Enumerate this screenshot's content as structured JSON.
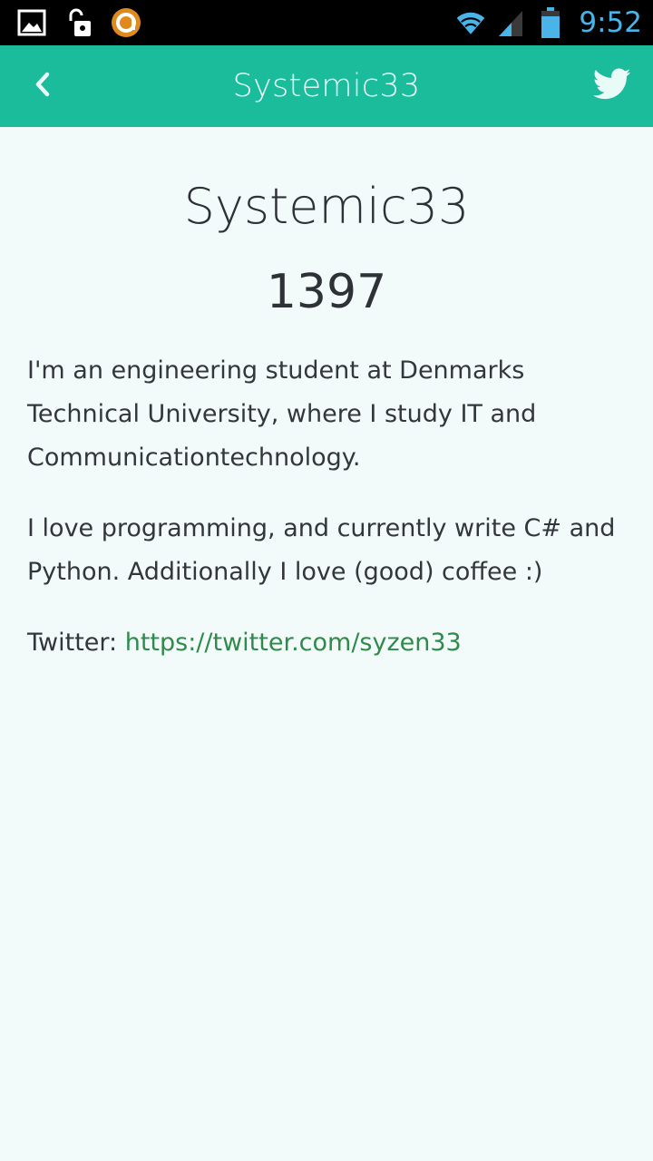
{
  "status_bar": {
    "time": "9:52",
    "icons": [
      "image-icon",
      "unlock-icon",
      "app-circle-icon",
      "wifi-icon",
      "signal-icon",
      "battery-icon"
    ]
  },
  "app_bar": {
    "title": "Systemic33",
    "color": "#1abc9c",
    "back_icon": "chevron-left-icon",
    "action_icon": "twitter-icon"
  },
  "profile": {
    "username": "Systemic33",
    "score": "1397",
    "about": {
      "paragraph1": "I'm an engineering student at Denmarks Technical University, where I study IT and Communicationtechnology.",
      "paragraph2": "I love programming, and currently write C# and Python. Additionally I love (good) coffee :)",
      "twitter_label": "Twitter:",
      "twitter_url": "https://twitter.com/syzen33"
    }
  }
}
